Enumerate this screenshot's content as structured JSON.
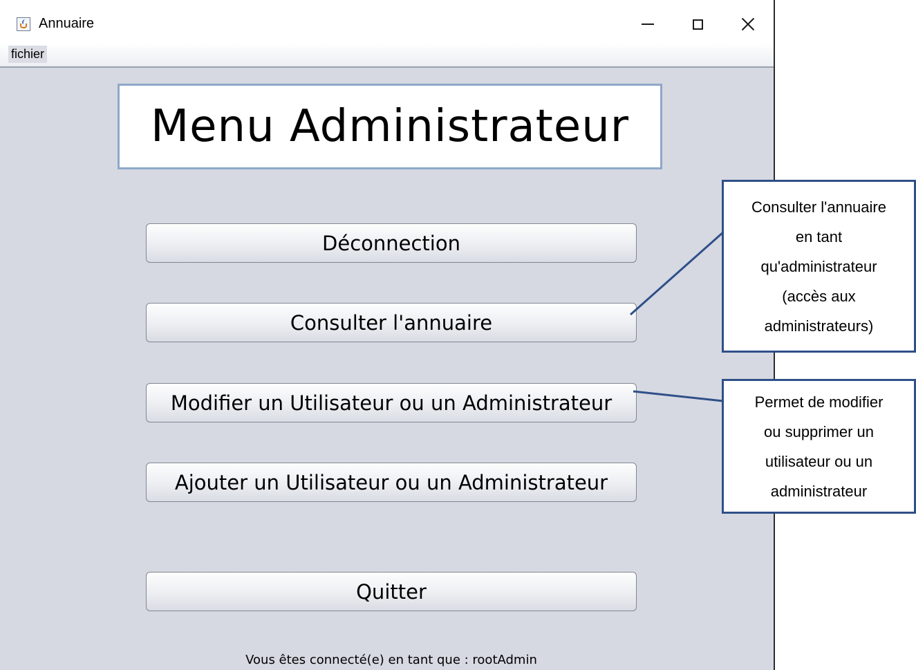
{
  "window": {
    "title": "Annuaire",
    "menu": {
      "fichier_label": "fichier"
    }
  },
  "main": {
    "heading": "Menu Administrateur",
    "buttons": {
      "deconnection": "Déconnection",
      "consulter": "Consulter l'annuaire",
      "modifier": "Modifier un Utilisateur ou un Administrateur",
      "ajouter": "Ajouter un Utilisateur ou un Administrateur",
      "quitter": "Quitter"
    },
    "status": "Vous êtes connecté(e) en tant que : rootAdmin"
  },
  "annotations": {
    "consulter_lines": [
      "Consulter l'annuaire",
      "en tant",
      "qu'administrateur",
      "(accès aux",
      "administrateurs)"
    ],
    "modifier_lines": [
      "Permet de modifier",
      "ou supprimer un",
      "utilisateur ou un",
      "administrateur"
    ]
  },
  "colors": {
    "window_bg": "#d6d9e2",
    "callout_border": "#2f4f88",
    "heading_border": "#8ea8c8"
  }
}
